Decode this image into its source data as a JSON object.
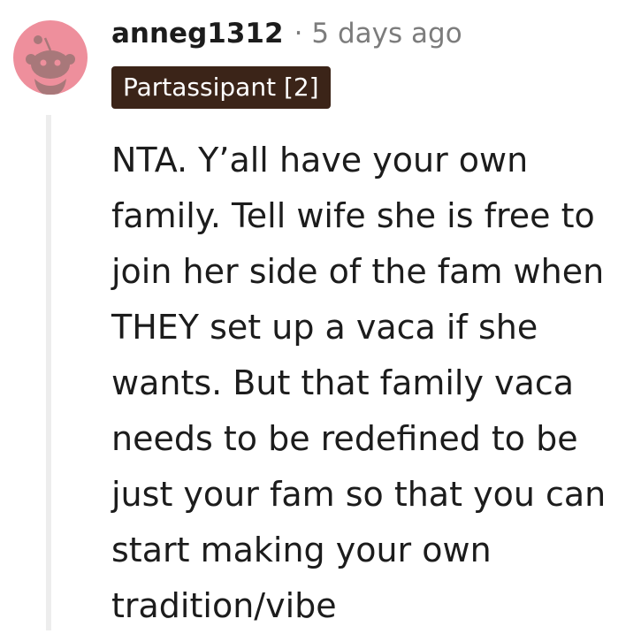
{
  "comment": {
    "author": "anneg1312",
    "separator": "·",
    "timestamp": "5 days ago",
    "flair": "Partassipant [2]",
    "avatar_icon": "snoo-avatar-icon",
    "body_lines": [
      "NTA. Y’all have your own",
      "family. Tell wife she is free to",
      "join her side of the fam when",
      "THEY set up a vaca if she",
      "wants. But that family vaca",
      "needs to be redefined to be",
      "just your fam so that you can",
      "start making your own",
      "tradition/vibe"
    ]
  },
  "colors": {
    "avatar_bg": "#ee8f9c",
    "avatar_figure": "#a8787a",
    "flair_bg": "#3b2418",
    "text": "#1c1c1c",
    "meta": "#7c7c7c",
    "thread_line": "#ededed"
  }
}
